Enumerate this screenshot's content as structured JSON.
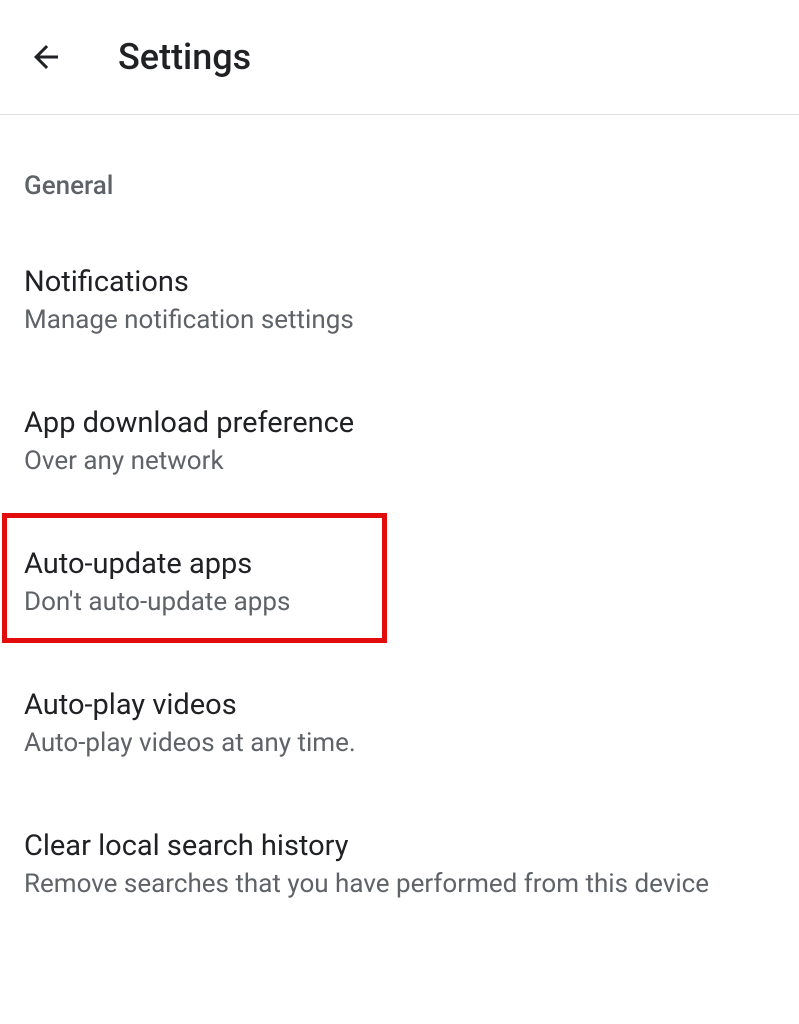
{
  "header": {
    "title": "Settings"
  },
  "section": {
    "label": "General"
  },
  "settings": [
    {
      "title": "Notifications",
      "subtitle": "Manage notification settings"
    },
    {
      "title": "App download preference",
      "subtitle": "Over any network"
    },
    {
      "title": "Auto-update apps",
      "subtitle": "Don't auto-update apps"
    },
    {
      "title": "Auto-play videos",
      "subtitle": "Auto-play videos at any time."
    },
    {
      "title": "Clear local search history",
      "subtitle": "Remove searches that you have performed from this device"
    }
  ]
}
